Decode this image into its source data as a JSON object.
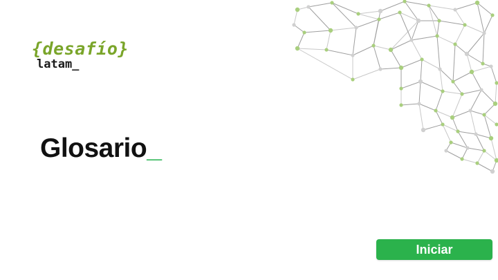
{
  "logo": {
    "line1": "{desafío}",
    "line2": "latam_"
  },
  "page": {
    "title": "Glosario",
    "title_cursor": "_"
  },
  "actions": {
    "start_label": "Iniciar"
  },
  "colors": {
    "brand_green": "#7aa52a",
    "accent_green": "#2bb24c",
    "text_dark": "#111111"
  },
  "decoration": {
    "icon": "network-graph-icon"
  }
}
